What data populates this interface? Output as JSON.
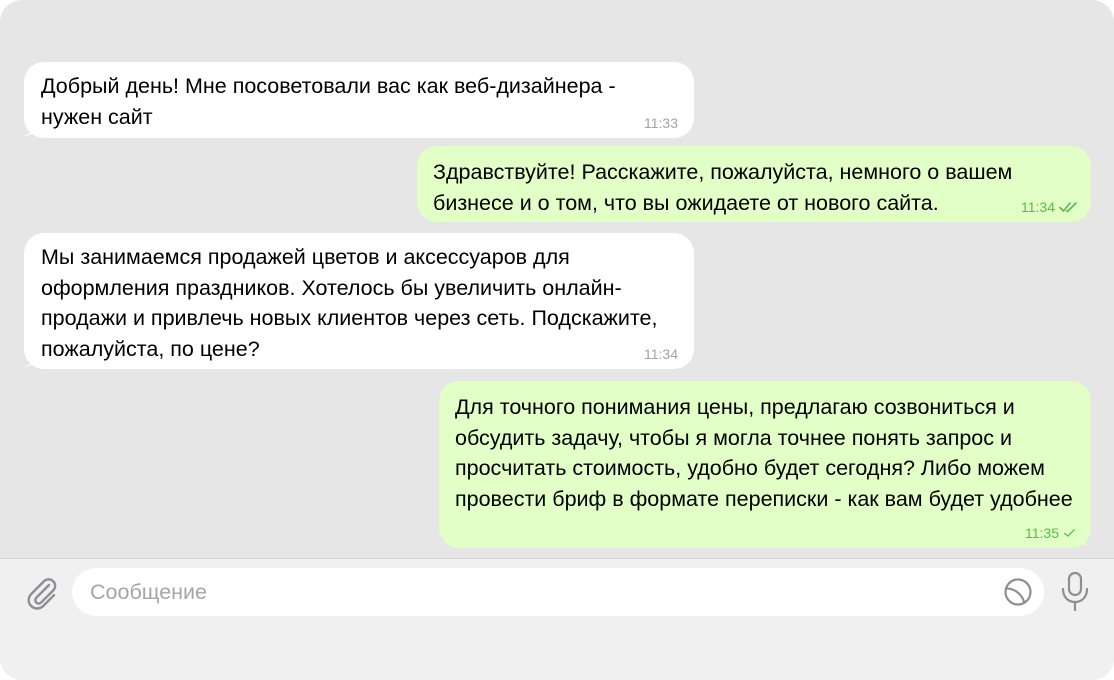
{
  "messages": [
    {
      "direction": "incoming",
      "text": "Добрый день! Мне посоветовали вас как веб-дизайнера - нужен сайт",
      "time": "11:33"
    },
    {
      "direction": "outgoing",
      "text": "Здравствуйте! Расскажите, пожалуйста, немного о вашем бизнесе и о том, что вы ожидаете от нового сайта.",
      "time": "11:34",
      "status": "read"
    },
    {
      "direction": "incoming",
      "text": "Мы занимаемся продажей цветов и аксессуаров для оформления праздников. Хотелось бы увеличить онлайн-продажи и привлечь новых клиентов через сеть. Подскажите, пожалуйста, по цене?",
      "time": "11:34"
    },
    {
      "direction": "outgoing",
      "text": "Для точного понимания цены, предлагаю созвониться и обсудить задачу, чтобы я могла точнее понять запрос и просчитать стоимость, удобно будет сегодня? Либо можем провести бриф в формате переписки - как вам будет удобнее",
      "time": "11:35",
      "status": "sent"
    }
  ],
  "composer": {
    "placeholder": "Сообщение",
    "value": ""
  },
  "icons": {
    "attach": "paperclip-icon",
    "sticker": "sticker-icon",
    "voice": "microphone-icon",
    "read_status": "double-check-icon",
    "sent_status": "check-icon"
  },
  "colors": {
    "chat_background": "#e6e6e6",
    "incoming_bubble": "#ffffff",
    "outgoing_bubble": "#e1ffc7",
    "outgoing_time": "#5eb84b",
    "incoming_time": "#a2a2a2",
    "input_bar": "#f0f0f0",
    "icon_gray": "#8e8e93",
    "placeholder": "#a6a6a6"
  }
}
